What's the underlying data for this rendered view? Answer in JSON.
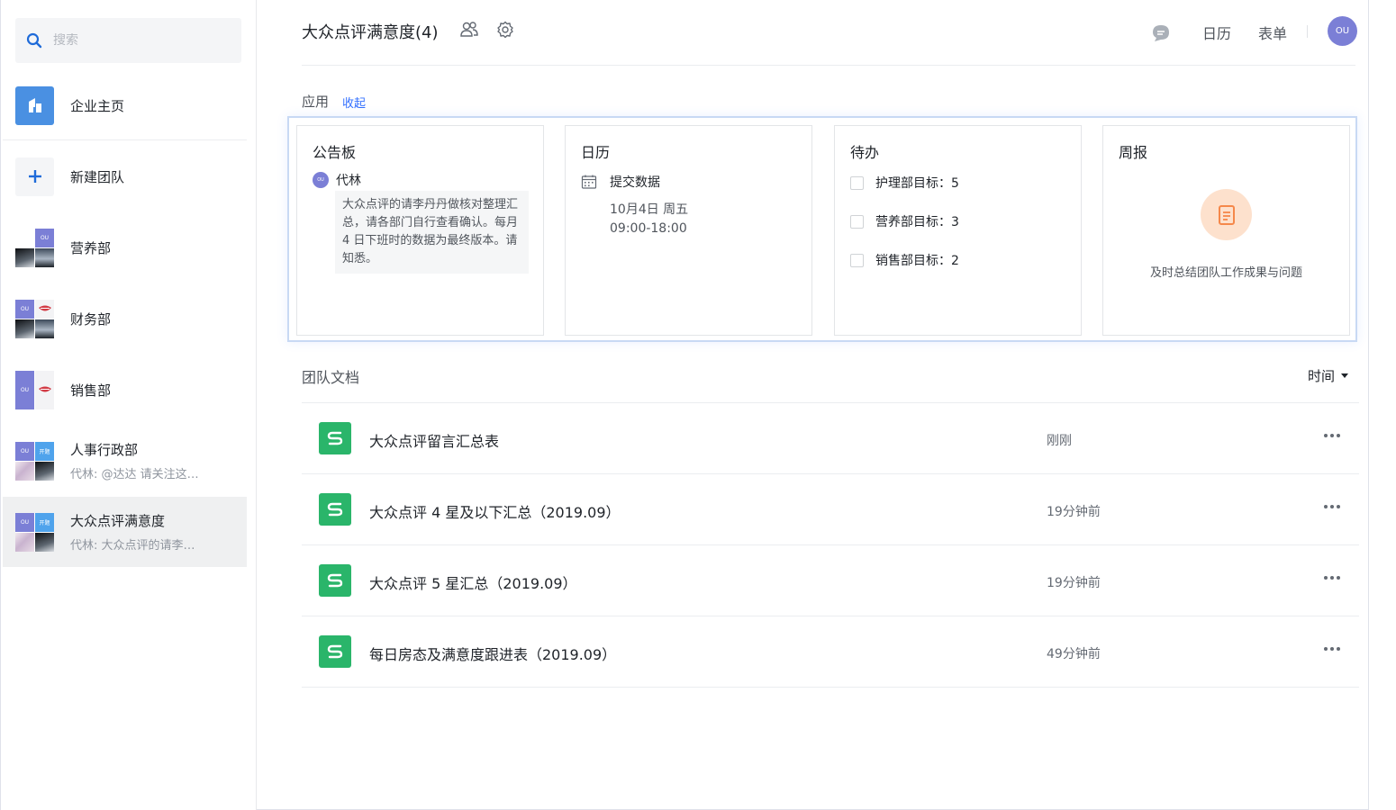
{
  "sidebar": {
    "search_placeholder": "搜索",
    "items": [
      {
        "label": "企业主页",
        "icon": "building-icon"
      },
      {
        "label": "新建团队",
        "icon": "plus-icon"
      },
      {
        "label": "营养部"
      },
      {
        "label": "财务部"
      },
      {
        "label": "销售部"
      },
      {
        "label": "人事行政部",
        "preview": "代林: @达达 请关注这…"
      },
      {
        "label": "大众点评满意度",
        "preview": "代林: 大众点评的请李…",
        "active": true
      }
    ],
    "avatar_tags": {
      "ou": "OU",
      "kai": "开题"
    }
  },
  "header": {
    "title": "大众点评满意度(4)",
    "calendar": "日历",
    "form": "表单",
    "user_initials": "OU"
  },
  "apps": {
    "label": "应用",
    "toggle": "收起",
    "cards": {
      "board": {
        "title": "公告板",
        "author": "代林",
        "author_initials": "OU",
        "message": "大众点评的请李丹丹做核对整理汇总，请各部门自行查看确认。每月 4 日下班时的数据为最终版本。请知悉。"
      },
      "calendar": {
        "title": "日历",
        "event": "提交数据",
        "date": "10月4日 周五",
        "time": "09:00-18:00"
      },
      "todo": {
        "title": "待办",
        "items": [
          "护理部目标：5",
          "营养部目标：3",
          "销售部目标：2"
        ]
      },
      "weekly": {
        "title": "周报",
        "description": "及时总结团队工作成果与问题"
      }
    }
  },
  "docs": {
    "label": "团队文档",
    "sort_label": "时间",
    "items": [
      {
        "name": "大众点评留言汇总表",
        "time": "刚刚"
      },
      {
        "name": "大众点评 4 星及以下汇总（2019.09）",
        "time": "19分钟前"
      },
      {
        "name": "大众点评 5 星汇总（2019.09）",
        "time": "19分钟前"
      },
      {
        "name": "每日房态及满意度跟进表（2019.09）",
        "time": "49分钟前"
      }
    ]
  },
  "colors": {
    "accent": "#3370ff",
    "sheet_green": "#2ab56a",
    "avatar_purple": "#7b7fd6",
    "weekly_orange": "#f5884a"
  }
}
